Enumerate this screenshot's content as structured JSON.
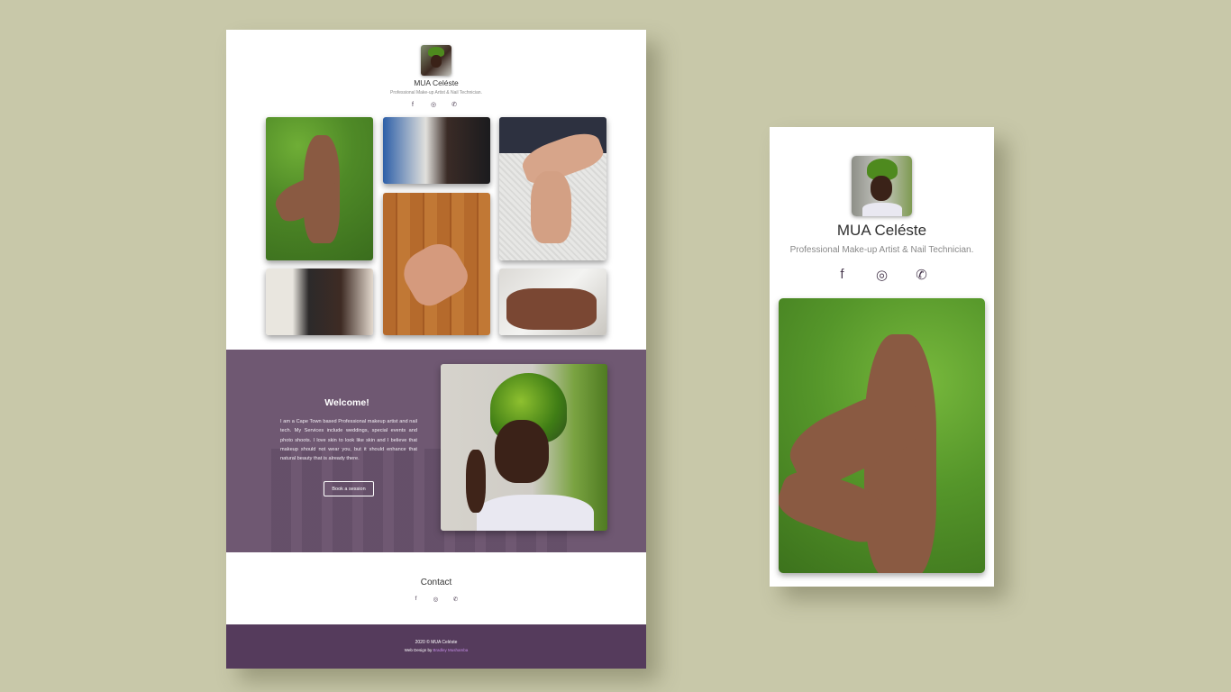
{
  "desktop": {
    "brand": {
      "name": "MUA Celéste",
      "tagline": "Professional Make-up Artist & Nail Technician."
    },
    "social": [
      {
        "icon": "facebook-icon",
        "glyph": "f"
      },
      {
        "icon": "instagram-icon",
        "glyph": "◎"
      },
      {
        "icon": "phone-icon",
        "glyph": "✆"
      }
    ],
    "welcome": {
      "title": "Welcome!",
      "text": "I am a Cape Town based Professional makeup artist and nail tech. My Services include weddings, special events and photo shoots. I love skin to look like skin and I believe that makeup should not wear you, but it should enhance that natural beauty that is already there.",
      "button": "Book a session"
    },
    "contact": {
      "title": "Contact"
    },
    "footer": {
      "copyright": "2020 © MUA Celéste",
      "design_prefix": "Web Design by ",
      "designer": "Bradley Mushamba"
    }
  },
  "mobile": {
    "brand": {
      "name": "MUA Celéste",
      "tagline": "Professional Make-up Artist & Nail Technician."
    },
    "social": [
      {
        "icon": "facebook-icon",
        "glyph": "f"
      },
      {
        "icon": "instagram-icon",
        "glyph": "◎"
      },
      {
        "icon": "phone-icon",
        "glyph": "✆"
      }
    ]
  },
  "colors": {
    "background": "#c8c8a9",
    "accent": "#6f5872",
    "footer": "#553b5c",
    "link": "#c38be5"
  }
}
